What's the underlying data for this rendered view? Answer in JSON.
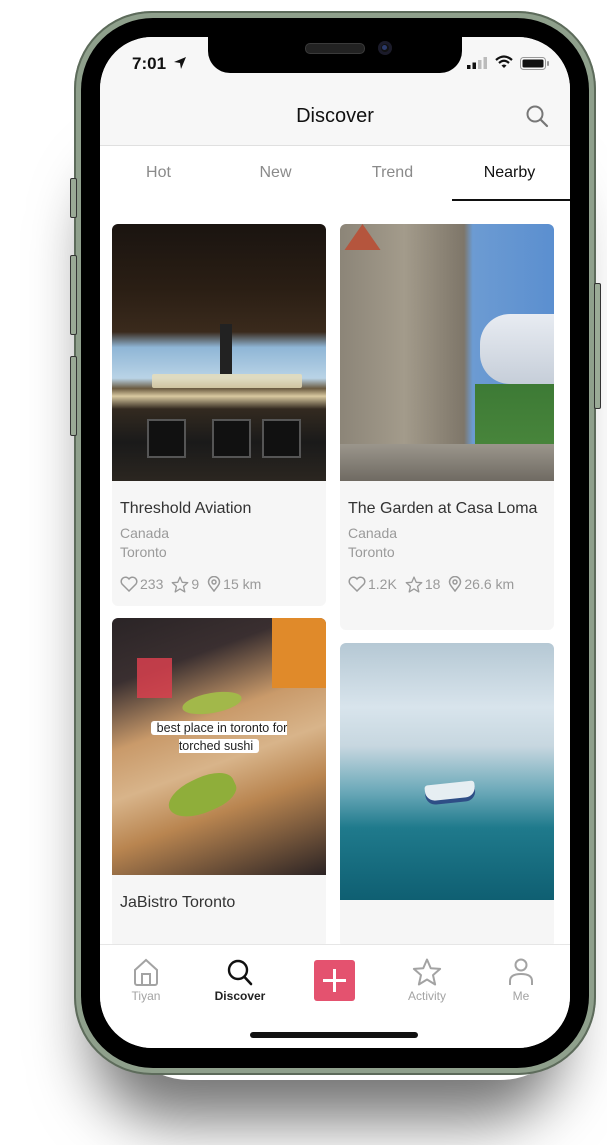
{
  "status_bar": {
    "time": "7:01",
    "location_icon": "location-arrow-icon",
    "signal_icon": "cellular-signal-icon",
    "wifi_icon": "wifi-icon",
    "battery_icon": "battery-icon"
  },
  "header": {
    "title": "Discover",
    "search_icon": "search-icon"
  },
  "tabs": [
    {
      "label": "Hot",
      "active": false
    },
    {
      "label": "New",
      "active": false
    },
    {
      "label": "Trend",
      "active": false
    },
    {
      "label": "Nearby",
      "active": true
    }
  ],
  "cards": [
    {
      "name": "Threshold Aviation",
      "country": "Canada",
      "city": "Toronto",
      "likes": "233",
      "stars": "9",
      "distance": "15 km",
      "image": "cockpit-photo"
    },
    {
      "name": "The Garden at Casa Loma",
      "country": "Canada",
      "city": "Toronto",
      "likes": "1.2K",
      "stars": "18",
      "distance": "26.6 km",
      "image": "castle-photo"
    },
    {
      "name": "JaBistro Toronto",
      "image": "torched-sushi-photo",
      "caption": "best place in toronto for torched sushi"
    },
    {
      "name": "",
      "image": "waterfall-boat-photo"
    }
  ],
  "tab_bar": {
    "items": [
      {
        "label": "Tiyan",
        "icon": "home-icon",
        "active": false
      },
      {
        "label": "Discover",
        "icon": "search-icon",
        "active": true
      },
      {
        "label": "",
        "icon": "plus-icon",
        "active": false
      },
      {
        "label": "Activity",
        "icon": "star-icon",
        "active": false
      },
      {
        "label": "Me",
        "icon": "person-icon",
        "active": false
      }
    ],
    "accent_color": "#e4526f"
  }
}
